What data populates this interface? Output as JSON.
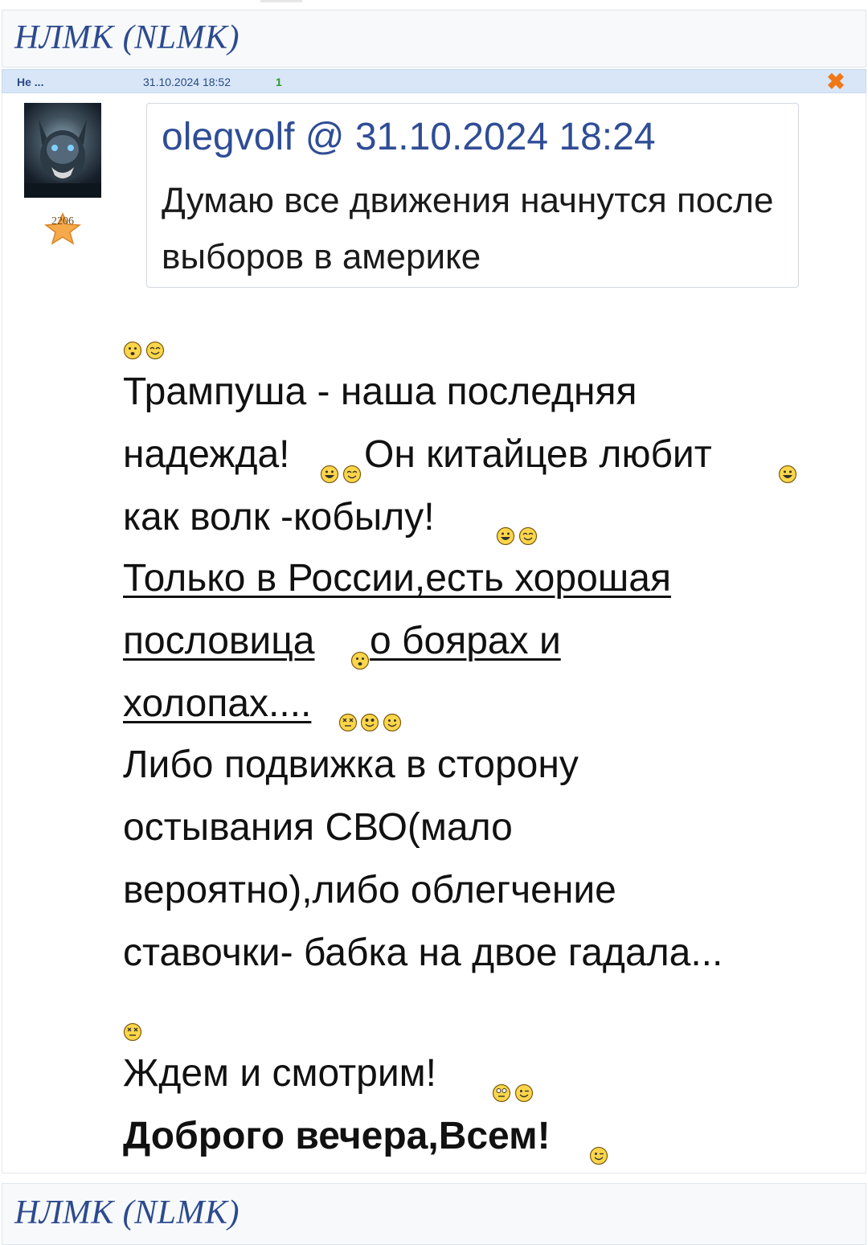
{
  "topic": {
    "title": "НЛМК (NLMK)"
  },
  "post": {
    "author_short": "Не ...",
    "datetime": "31.10.2024 18:52",
    "reply_count": "1",
    "rank": "2206",
    "quote": {
      "header": "olegvolf @ 31.10.2024 18:24",
      "text": "Думаю все движения начнутся после выборов в америке"
    },
    "lines": [
      "Трампуша - наша последняя",
      "надежда!",
      " Он китайцев любит",
      "как волк -кобылу!",
      "Только в России,есть хорошая",
      "пословица",
      " о боярах и",
      "холопах....",
      "Либо подвижка в сторону",
      "остывания СВО(мало",
      "вероятно),либо облегчение",
      "ставочки- бабка на двое гадала...",
      "Ждем и смотрим!",
      "Доброго вечера,Всем!"
    ]
  },
  "footer": {
    "title": "НЛМК (NLMK)"
  },
  "colors": {
    "link_blue": "#2f4d96",
    "meta_bar": "#d8e6f8",
    "close_orange": "#f07818",
    "count_green": "#2e9a2a"
  },
  "icons": {
    "close": "close-icon",
    "rank": "star-icon",
    "smiley": "smiley-icon"
  }
}
